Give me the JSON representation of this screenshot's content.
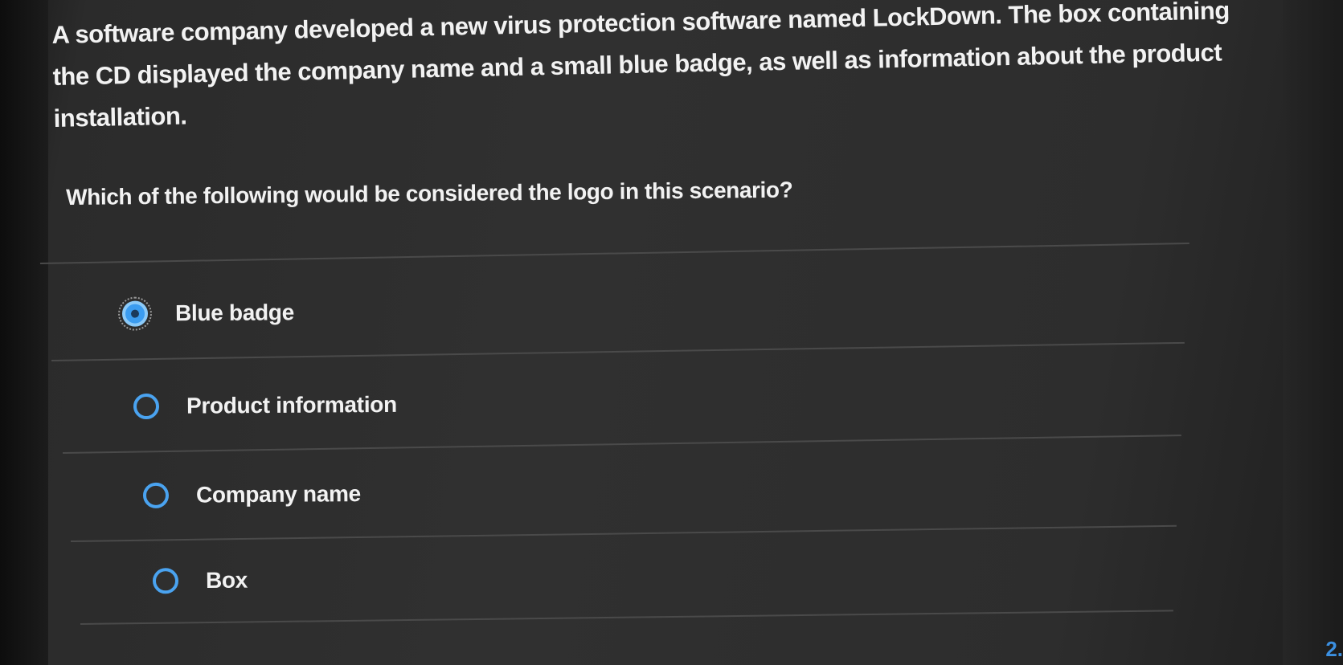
{
  "prompt": {
    "line1": "A software company developed a new virus protection software named LockDown. The box containing",
    "line2": "the CD displayed the company name and a small blue badge, as well as information about the product",
    "line3": "installation."
  },
  "question": "Which of the following would be considered the logo in this scenario?",
  "options": [
    {
      "label": "Blue badge",
      "selected": true
    },
    {
      "label": "Product information",
      "selected": false
    },
    {
      "label": "Company name",
      "selected": false
    },
    {
      "label": "Box",
      "selected": false
    }
  ],
  "page_indicator": "2.",
  "colors": {
    "accent": "#3b9cf0",
    "background": "#2f2f2f",
    "text": "#f2f2f2"
  }
}
